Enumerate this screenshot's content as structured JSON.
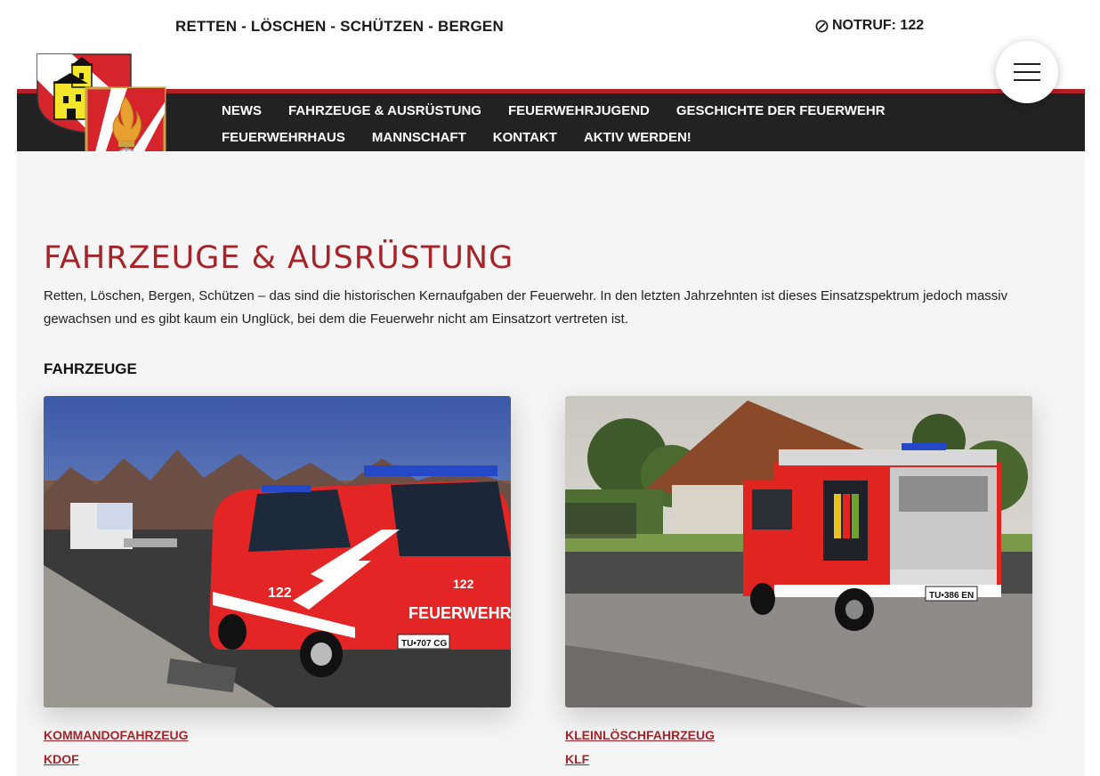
{
  "header": {
    "slogan": "RETTEN - LÖSCHEN - SCHÜTZEN - BERGEN",
    "emergency": "NOTRUF: 122"
  },
  "nav": {
    "items": [
      {
        "label": "NEWS"
      },
      {
        "label": "FAHRZEUGE & AUSRÜSTUNG"
      },
      {
        "label": "FEUERWEHRJUGEND"
      },
      {
        "label": "GESCHICHTE DER FEUERWEHR"
      },
      {
        "label": "FEUERWEHRHAUS"
      },
      {
        "label": "MANNSCHAFT"
      },
      {
        "label": "KONTAKT"
      },
      {
        "label": "AKTIV WERDEN!"
      }
    ]
  },
  "page": {
    "title": "FAHRZEUGE & AUSRÜSTUNG",
    "intro": "Retten, Löschen, Bergen, Schützen – das sind die historischen Kernaufgaben der Feuerwehr. In den letzten Jahrzehnten ist dieses Einsatzspektrum jedoch massiv gewachsen und es gibt kaum ein Unglück, bei dem die Feuerwehr nicht am Einsatzort vertreten ist.",
    "section_title": "FAHRZEUGE"
  },
  "vehicles": [
    {
      "name": "KOMMANDOFAHRZEUG",
      "abbr": "KDOF",
      "door_text": "FEUERWEHR",
      "number": "122",
      "plate": "TU•707 CG"
    },
    {
      "name": "KLEINLÖSCHFAHRZEUG",
      "abbr": "KLF",
      "plate": "TU•386 EN"
    }
  ],
  "colors": {
    "accent": "#a5242a",
    "nav_bg": "#222222",
    "nav_border": "#b31f26",
    "content_bg": "#f5f5f5"
  }
}
